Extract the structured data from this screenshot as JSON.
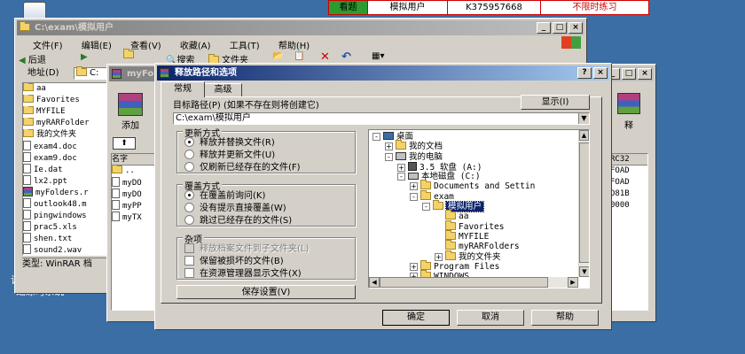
{
  "top_strip": {
    "tab": "看题",
    "user": "模拟用户",
    "code": "K375957668",
    "mode": "不限时练习"
  },
  "desktop": {
    "bottom_label_line1": "计算机应用基",
    "bottom_label_line2": "础练习系统"
  },
  "explorer": {
    "title": "C:\\exam\\模拟用户",
    "menu": [
      "文件(F)",
      "编辑(E)",
      "查看(V)",
      "收藏(A)",
      "工具(T)",
      "帮助(H)"
    ],
    "toolbar": {
      "back": "后退",
      "search": "搜索",
      "folders": "文件夹"
    },
    "address_label": "地址(D)",
    "address_value": "C:",
    "files": [
      "aa",
      "Favorites",
      "MYFILE",
      "myRARFolder",
      "我的文件夹",
      "exam4.doc",
      "exam9.doc",
      "Ie.dat",
      "lx2.ppt",
      "myFolders.r",
      "outlook48.m",
      "pingwindows",
      "prac5.xls",
      "shen.txt",
      "sound2.wav"
    ],
    "status": "类型: WinRAR 档"
  },
  "winrar": {
    "title": "myFo",
    "add_label": "添加",
    "col_name": "名字",
    "files": [
      "..",
      "myDO",
      "myDO",
      "myPP",
      "myTX"
    ],
    "right_title": "释",
    "right_col": "RC32",
    "right_values": [
      "FOAD",
      "FOAD",
      "D81B",
      "0000"
    ]
  },
  "dialog": {
    "title": "释放路径和选项",
    "tabs": [
      "常规",
      "高级"
    ],
    "target_label": "目标路径(P) (如果不存在则将创建它)",
    "target_value": "C:\\exam\\模拟用户",
    "show_button": "显示(I)",
    "update_group": {
      "label": "更新方式",
      "options": [
        "释放并替换文件(R)",
        "释放并更新文件(U)",
        "仅刷新已经存在的文件(F)"
      ],
      "selected": 0
    },
    "overwrite_group": {
      "label": "覆盖方式",
      "options": [
        "在覆盖前询问(K)",
        "没有提示直接覆盖(W)",
        "跳过已经存在的文件(S)"
      ],
      "selected": 0
    },
    "misc_group": {
      "label": "杂项",
      "options": [
        "释放档案文件到子文件夹(L)",
        "保留被损坏的文件(B)",
        "在资源管理器显示文件(X)"
      ]
    },
    "save_button": "保存设置(V)",
    "tree": [
      {
        "label": "桌面",
        "level": 0,
        "toggle": "-",
        "icon": "desktop"
      },
      {
        "label": "我的文档",
        "level": 1,
        "toggle": "+",
        "icon": "folder"
      },
      {
        "label": "我的电脑",
        "level": 1,
        "toggle": "-",
        "icon": "computer"
      },
      {
        "label": "3.5 软盘 (A:)",
        "level": 2,
        "toggle": "+",
        "icon": "floppy"
      },
      {
        "label": "本地磁盘 (C:)",
        "level": 2,
        "toggle": "-",
        "icon": "drive"
      },
      {
        "label": "Documents and Settin",
        "level": 3,
        "toggle": "+",
        "icon": "folder"
      },
      {
        "label": "exam",
        "level": 3,
        "toggle": "-",
        "icon": "folder"
      },
      {
        "label": "模拟用户",
        "level": 4,
        "toggle": "-",
        "icon": "folder",
        "selected": true
      },
      {
        "label": "aa",
        "level": 5,
        "toggle": "",
        "icon": "folder"
      },
      {
        "label": "Favorites",
        "level": 5,
        "toggle": "",
        "icon": "folder"
      },
      {
        "label": "MYFILE",
        "level": 5,
        "toggle": "",
        "icon": "folder"
      },
      {
        "label": "myRARFolders",
        "level": 5,
        "toggle": "",
        "icon": "folder"
      },
      {
        "label": "我的文件夹",
        "level": 5,
        "toggle": "+",
        "icon": "folder"
      },
      {
        "label": "Program Files",
        "level": 3,
        "toggle": "+",
        "icon": "folder"
      },
      {
        "label": "WINDOWS",
        "level": 3,
        "toggle": "+",
        "icon": "folder"
      },
      {
        "label": "Wysoft",
        "level": 3,
        "toggle": "+",
        "icon": "folder"
      }
    ],
    "ok": "确定",
    "cancel": "取消",
    "help": "帮助"
  },
  "colors": {
    "desktop": "#3a6ea5",
    "title_active": "#0a246a",
    "window_face": "#d4d0c8",
    "mode_red": "#cc0000",
    "tab_green": "#2e9b2e"
  }
}
